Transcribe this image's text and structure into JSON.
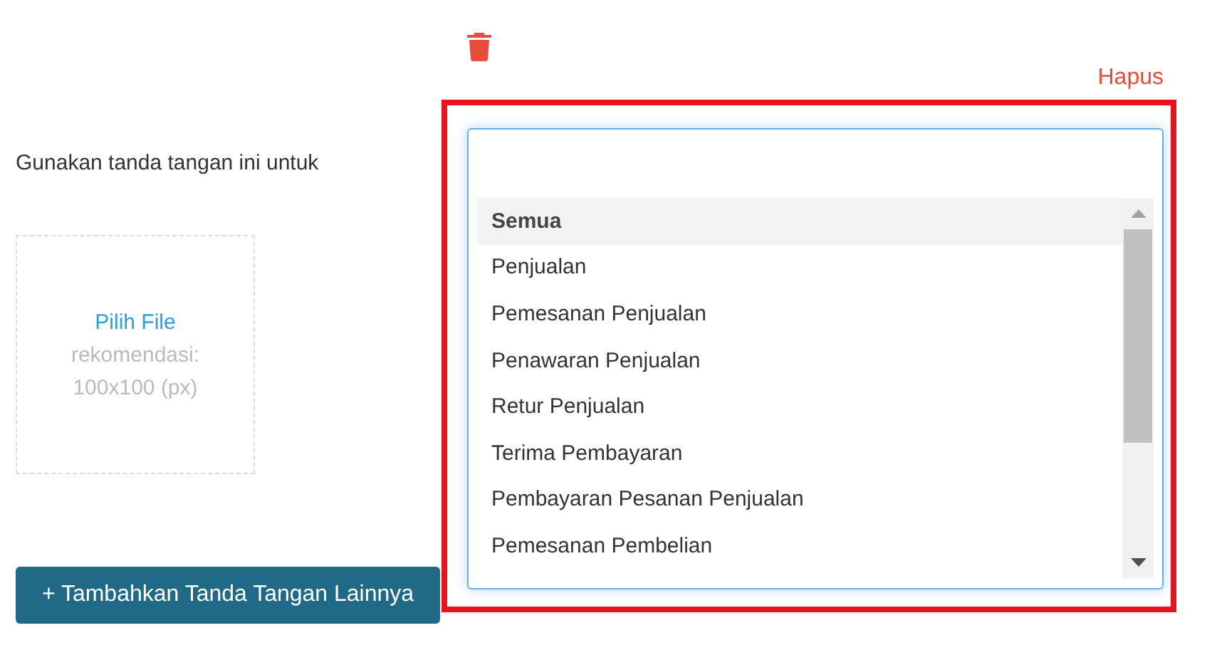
{
  "usage_label": "Gunakan tanda tangan ini untuk",
  "upload": {
    "link": "Pilih File",
    "hint_lines": [
      "rekomendasi:",
      "100x100 (px)"
    ]
  },
  "add_button": "+ Tambahkan Tanda Tangan Lainnya",
  "delete_label": "Hapus",
  "dropdown": {
    "items": [
      {
        "label": "Semua",
        "selected": true
      },
      {
        "label": "Penjualan",
        "selected": false
      },
      {
        "label": "Pemesanan Penjualan",
        "selected": false
      },
      {
        "label": "Penawaran Penjualan",
        "selected": false
      },
      {
        "label": "Retur Penjualan",
        "selected": false
      },
      {
        "label": "Terima Pembayaran",
        "selected": false
      },
      {
        "label": "Pembayaran Pesanan Penjualan",
        "selected": false
      },
      {
        "label": "Pemesanan Pembelian",
        "selected": false
      }
    ]
  }
}
